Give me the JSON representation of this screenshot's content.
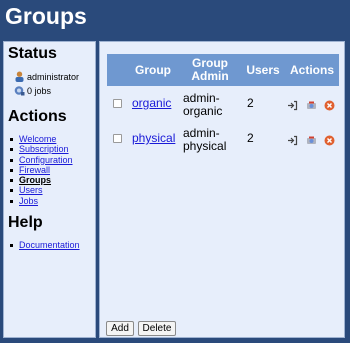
{
  "page": {
    "title": "Groups"
  },
  "sidebar": {
    "status_heading": "Status",
    "user": "administrator",
    "jobs": "0 jobs",
    "actions_heading": "Actions",
    "actions": [
      {
        "label": "Welcome"
      },
      {
        "label": "Subscription"
      },
      {
        "label": "Configuration"
      },
      {
        "label": "Firewall"
      },
      {
        "label": "Groups",
        "current": true
      },
      {
        "label": "Users"
      },
      {
        "label": "Jobs"
      }
    ],
    "help_heading": "Help",
    "help": [
      {
        "label": "Documentation"
      }
    ]
  },
  "table": {
    "columns": [
      "Group",
      "Group Admin",
      "Users",
      "Actions"
    ],
    "rows": [
      {
        "group": "organic",
        "admin_line1": "admin-",
        "admin_line2": "organic",
        "users": "2",
        "checked": false
      },
      {
        "group": "physical",
        "admin_line1": "admin-",
        "admin_line2": "physical",
        "users": "2",
        "checked": false
      }
    ],
    "row_actions": [
      "login-icon",
      "edit-icon",
      "delete-icon"
    ]
  },
  "buttons": {
    "add": "Add",
    "delete": "Delete"
  },
  "colors": {
    "background": "#2a4a7b",
    "panel": "#e7eefb",
    "header": "#6f98d0",
    "link": "#1a1ad8",
    "delete": "#e06030"
  }
}
